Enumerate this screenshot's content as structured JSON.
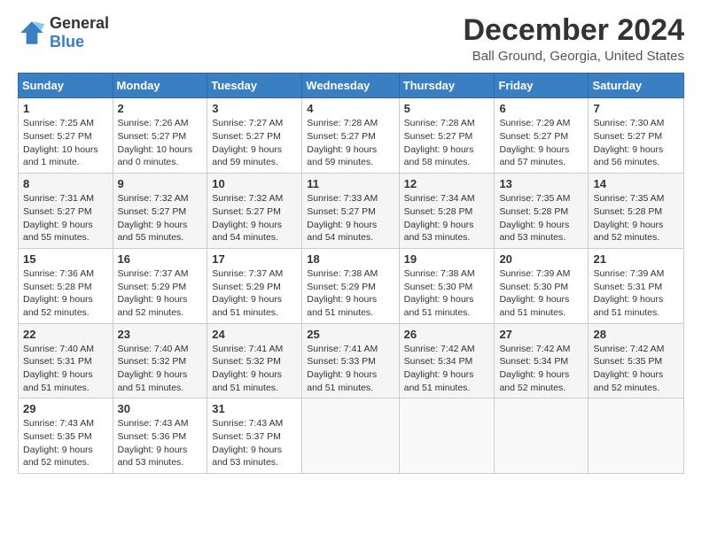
{
  "logo": {
    "text_general": "General",
    "text_blue": "Blue"
  },
  "header": {
    "month": "December 2024",
    "location": "Ball Ground, Georgia, United States"
  },
  "weekdays": [
    "Sunday",
    "Monday",
    "Tuesday",
    "Wednesday",
    "Thursday",
    "Friday",
    "Saturday"
  ],
  "weeks": [
    [
      {
        "day": 1,
        "sunrise": "7:25 AM",
        "sunset": "5:27 PM",
        "daylight": "10 hours and 1 minute."
      },
      {
        "day": 2,
        "sunrise": "7:26 AM",
        "sunset": "5:27 PM",
        "daylight": "10 hours and 0 minutes."
      },
      {
        "day": 3,
        "sunrise": "7:27 AM",
        "sunset": "5:27 PM",
        "daylight": "9 hours and 59 minutes."
      },
      {
        "day": 4,
        "sunrise": "7:28 AM",
        "sunset": "5:27 PM",
        "daylight": "9 hours and 59 minutes."
      },
      {
        "day": 5,
        "sunrise": "7:28 AM",
        "sunset": "5:27 PM",
        "daylight": "9 hours and 58 minutes."
      },
      {
        "day": 6,
        "sunrise": "7:29 AM",
        "sunset": "5:27 PM",
        "daylight": "9 hours and 57 minutes."
      },
      {
        "day": 7,
        "sunrise": "7:30 AM",
        "sunset": "5:27 PM",
        "daylight": "9 hours and 56 minutes."
      }
    ],
    [
      {
        "day": 8,
        "sunrise": "7:31 AM",
        "sunset": "5:27 PM",
        "daylight": "9 hours and 55 minutes."
      },
      {
        "day": 9,
        "sunrise": "7:32 AM",
        "sunset": "5:27 PM",
        "daylight": "9 hours and 55 minutes."
      },
      {
        "day": 10,
        "sunrise": "7:32 AM",
        "sunset": "5:27 PM",
        "daylight": "9 hours and 54 minutes."
      },
      {
        "day": 11,
        "sunrise": "7:33 AM",
        "sunset": "5:27 PM",
        "daylight": "9 hours and 54 minutes."
      },
      {
        "day": 12,
        "sunrise": "7:34 AM",
        "sunset": "5:28 PM",
        "daylight": "9 hours and 53 minutes."
      },
      {
        "day": 13,
        "sunrise": "7:35 AM",
        "sunset": "5:28 PM",
        "daylight": "9 hours and 53 minutes."
      },
      {
        "day": 14,
        "sunrise": "7:35 AM",
        "sunset": "5:28 PM",
        "daylight": "9 hours and 52 minutes."
      }
    ],
    [
      {
        "day": 15,
        "sunrise": "7:36 AM",
        "sunset": "5:28 PM",
        "daylight": "9 hours and 52 minutes."
      },
      {
        "day": 16,
        "sunrise": "7:37 AM",
        "sunset": "5:29 PM",
        "daylight": "9 hours and 52 minutes."
      },
      {
        "day": 17,
        "sunrise": "7:37 AM",
        "sunset": "5:29 PM",
        "daylight": "9 hours and 51 minutes."
      },
      {
        "day": 18,
        "sunrise": "7:38 AM",
        "sunset": "5:29 PM",
        "daylight": "9 hours and 51 minutes."
      },
      {
        "day": 19,
        "sunrise": "7:38 AM",
        "sunset": "5:30 PM",
        "daylight": "9 hours and 51 minutes."
      },
      {
        "day": 20,
        "sunrise": "7:39 AM",
        "sunset": "5:30 PM",
        "daylight": "9 hours and 51 minutes."
      },
      {
        "day": 21,
        "sunrise": "7:39 AM",
        "sunset": "5:31 PM",
        "daylight": "9 hours and 51 minutes."
      }
    ],
    [
      {
        "day": 22,
        "sunrise": "7:40 AM",
        "sunset": "5:31 PM",
        "daylight": "9 hours and 51 minutes."
      },
      {
        "day": 23,
        "sunrise": "7:40 AM",
        "sunset": "5:32 PM",
        "daylight": "9 hours and 51 minutes."
      },
      {
        "day": 24,
        "sunrise": "7:41 AM",
        "sunset": "5:32 PM",
        "daylight": "9 hours and 51 minutes."
      },
      {
        "day": 25,
        "sunrise": "7:41 AM",
        "sunset": "5:33 PM",
        "daylight": "9 hours and 51 minutes."
      },
      {
        "day": 26,
        "sunrise": "7:42 AM",
        "sunset": "5:34 PM",
        "daylight": "9 hours and 51 minutes."
      },
      {
        "day": 27,
        "sunrise": "7:42 AM",
        "sunset": "5:34 PM",
        "daylight": "9 hours and 52 minutes."
      },
      {
        "day": 28,
        "sunrise": "7:42 AM",
        "sunset": "5:35 PM",
        "daylight": "9 hours and 52 minutes."
      }
    ],
    [
      {
        "day": 29,
        "sunrise": "7:43 AM",
        "sunset": "5:35 PM",
        "daylight": "9 hours and 52 minutes."
      },
      {
        "day": 30,
        "sunrise": "7:43 AM",
        "sunset": "5:36 PM",
        "daylight": "9 hours and 53 minutes."
      },
      {
        "day": 31,
        "sunrise": "7:43 AM",
        "sunset": "5:37 PM",
        "daylight": "9 hours and 53 minutes."
      },
      null,
      null,
      null,
      null
    ]
  ],
  "labels": {
    "sunrise": "Sunrise:",
    "sunset": "Sunset:",
    "daylight": "Daylight:"
  }
}
